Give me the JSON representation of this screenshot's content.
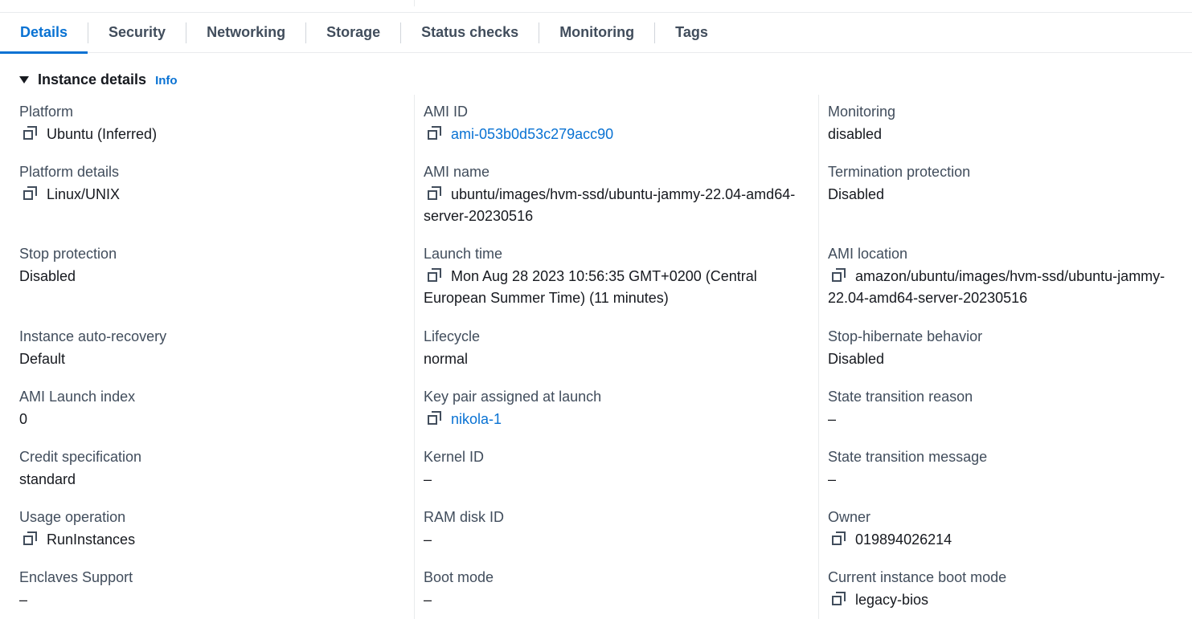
{
  "tabs": [
    {
      "label": "Details",
      "active": true
    },
    {
      "label": "Security",
      "active": false
    },
    {
      "label": "Networking",
      "active": false
    },
    {
      "label": "Storage",
      "active": false
    },
    {
      "label": "Status checks",
      "active": false
    },
    {
      "label": "Monitoring",
      "active": false
    },
    {
      "label": "Tags",
      "active": false
    }
  ],
  "section": {
    "title": "Instance details",
    "info": "Info"
  },
  "columns": [
    [
      {
        "label": "Platform",
        "value": "Ubuntu (Inferred)",
        "copy": true,
        "link": false
      },
      {
        "label": "Platform details",
        "value": "Linux/UNIX",
        "copy": true,
        "link": false
      },
      {
        "label": "Stop protection",
        "value": "Disabled",
        "copy": false,
        "link": false
      },
      {
        "label": "Instance auto-recovery",
        "value": "Default",
        "copy": false,
        "link": false
      },
      {
        "label": "AMI Launch index",
        "value": "0",
        "copy": false,
        "link": false
      },
      {
        "label": "Credit specification",
        "value": "standard",
        "copy": false,
        "link": false
      },
      {
        "label": "Usage operation",
        "value": "RunInstances",
        "copy": true,
        "link": false
      },
      {
        "label": "Enclaves Support",
        "value": "–",
        "copy": false,
        "link": false
      }
    ],
    [
      {
        "label": "AMI ID",
        "value": "ami-053b0d53c279acc90",
        "copy": true,
        "link": true
      },
      {
        "label": "AMI name",
        "value": "ubuntu/images/hvm-ssd/ubuntu-jammy-22.04-amd64-server-20230516",
        "copy": true,
        "link": false
      },
      {
        "label": "Launch time",
        "value": "Mon Aug 28 2023 10:56:35 GMT+0200 (Central European Summer Time) (11 minutes)",
        "copy": true,
        "link": false
      },
      {
        "label": "Lifecycle",
        "value": "normal",
        "copy": false,
        "link": false
      },
      {
        "label": "Key pair assigned at launch",
        "value": "nikola-1",
        "copy": true,
        "link": true
      },
      {
        "label": "Kernel ID",
        "value": "–",
        "copy": false,
        "link": false
      },
      {
        "label": "RAM disk ID",
        "value": "–",
        "copy": false,
        "link": false
      },
      {
        "label": "Boot mode",
        "value": "–",
        "copy": false,
        "link": false
      }
    ],
    [
      {
        "label": "Monitoring",
        "value": "disabled",
        "copy": false,
        "link": false
      },
      {
        "label": "Termination protection",
        "value": "Disabled",
        "copy": false,
        "link": false
      },
      {
        "label": "AMI location",
        "value": "amazon/ubuntu/images/hvm-ssd/ubuntu-jammy-22.04-amd64-server-20230516",
        "copy": true,
        "link": false
      },
      {
        "label": "Stop-hibernate behavior",
        "value": "Disabled",
        "copy": false,
        "link": false
      },
      {
        "label": "State transition reason",
        "value": "–",
        "copy": false,
        "link": false
      },
      {
        "label": "State transition message",
        "value": "–",
        "copy": false,
        "link": false
      },
      {
        "label": "Owner",
        "value": "019894026214",
        "copy": true,
        "link": false
      },
      {
        "label": "Current instance boot mode",
        "value": "legacy-bios",
        "copy": true,
        "link": false
      }
    ]
  ],
  "colors": {
    "accent": "#0972d3",
    "text": "#16191f",
    "label": "#414d5c",
    "divider": "#e9ebed"
  }
}
